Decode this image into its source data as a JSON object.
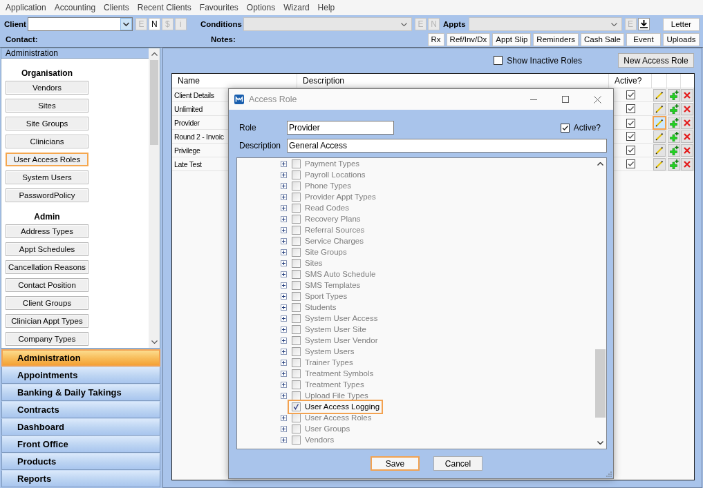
{
  "menu_bar": [
    "Application",
    "Accounting",
    "Clients",
    "Recent Clients",
    "Favourites",
    "Options",
    "Wizard",
    "Help"
  ],
  "toolbar": {
    "lookups": [
      {
        "label": "Client",
        "disabled": false,
        "buttons": [
          {
            "kind": "letter",
            "label": "E",
            "disabled": true
          },
          {
            "kind": "letter",
            "label": "N",
            "disabled": false
          },
          {
            "kind": "letter",
            "label": "$",
            "disabled": true
          },
          {
            "kind": "letter",
            "label": "i",
            "disabled": true
          }
        ]
      },
      {
        "label": "Conditions",
        "disabled": true,
        "buttons": [
          {
            "kind": "letter",
            "label": "E",
            "disabled": true
          },
          {
            "kind": "letter",
            "label": "N",
            "disabled": true
          }
        ]
      },
      {
        "label": "Appts",
        "disabled": true,
        "buttons": [
          {
            "kind": "letter",
            "label": "E",
            "disabled": true
          },
          {
            "kind": "download",
            "disabled": false
          }
        ]
      }
    ],
    "letter_button": "Letter",
    "contact_label": "Contact:",
    "notes_label": "Notes:",
    "buttons": [
      "Rx",
      "Ref/Inv/Dx",
      "Appt Slip",
      "Reminders",
      "Cash Sale",
      "Event",
      "Uploads"
    ]
  },
  "sidebar": {
    "header": "Administration",
    "sections": [
      {
        "title": "Organisation",
        "items": [
          {
            "label": "Vendors",
            "highlighted": false
          },
          {
            "label": "Sites",
            "highlighted": false
          },
          {
            "label": "Site Groups",
            "highlighted": false
          },
          {
            "label": "Clinicians",
            "highlighted": false
          },
          {
            "label": "User Access Roles",
            "highlighted": true
          },
          {
            "label": "System Users",
            "highlighted": false
          },
          {
            "label": "PasswordPolicy",
            "highlighted": false
          }
        ]
      },
      {
        "title": "Admin",
        "items": [
          {
            "label": "Address Types",
            "highlighted": false
          },
          {
            "label": "Appt Schedules",
            "highlighted": false
          },
          {
            "label": "Cancellation Reasons",
            "highlighted": false
          },
          {
            "label": "Contact Position",
            "highlighted": false
          },
          {
            "label": "Client Groups",
            "highlighted": false
          },
          {
            "label": "Clinician Appt Types",
            "highlighted": false
          },
          {
            "label": "Company Types",
            "highlighted": false
          }
        ]
      }
    ],
    "nav": [
      {
        "label": "Administration",
        "selected": true
      },
      {
        "label": "Appointments",
        "selected": false
      },
      {
        "label": "Banking & Daily Takings",
        "selected": false
      },
      {
        "label": "Contracts",
        "selected": false
      },
      {
        "label": "Dashboard",
        "selected": false
      },
      {
        "label": "Front Office",
        "selected": false
      },
      {
        "label": "Products",
        "selected": false
      },
      {
        "label": "Reports",
        "selected": false
      }
    ]
  },
  "roles_panel": {
    "show_inactive": {
      "label": "Show Inactive Roles",
      "checked": false
    },
    "new_button": "New Access Role",
    "table": {
      "columns": [
        "Name",
        "Description",
        "Active?"
      ],
      "rows": [
        {
          "name": "Client Details",
          "active": true,
          "edit_highlighted": false
        },
        {
          "name": "Unlimited",
          "active": true,
          "edit_highlighted": false
        },
        {
          "name": "Provider",
          "active": true,
          "edit_highlighted": true
        },
        {
          "name": "Round 2 - Invoic",
          "active": true,
          "edit_highlighted": false
        },
        {
          "name": "Privilege",
          "active": true,
          "edit_highlighted": false
        },
        {
          "name": "Late Test",
          "active": true,
          "edit_highlighted": false
        }
      ]
    }
  },
  "dialog": {
    "title": "Access Role",
    "role_label": "Role",
    "role_value": "Provider",
    "active": {
      "label": "Active?",
      "checked": true
    },
    "description_label": "Description",
    "description_value": "General Access",
    "tree": [
      {
        "label": "Payment Types",
        "expandable": true,
        "checked": false,
        "highlighted": false
      },
      {
        "label": "Payroll Locations",
        "expandable": true,
        "checked": false,
        "highlighted": false
      },
      {
        "label": "Phone Types",
        "expandable": true,
        "checked": false,
        "highlighted": false
      },
      {
        "label": "Provider Appt Types",
        "expandable": true,
        "checked": false,
        "highlighted": false
      },
      {
        "label": "Read Codes",
        "expandable": true,
        "checked": false,
        "highlighted": false
      },
      {
        "label": "Recovery Plans",
        "expandable": true,
        "checked": false,
        "highlighted": false
      },
      {
        "label": "Referral Sources",
        "expandable": true,
        "checked": false,
        "highlighted": false
      },
      {
        "label": "Service Charges",
        "expandable": true,
        "checked": false,
        "highlighted": false
      },
      {
        "label": "Site Groups",
        "expandable": true,
        "checked": false,
        "highlighted": false
      },
      {
        "label": "Sites",
        "expandable": true,
        "checked": false,
        "highlighted": false
      },
      {
        "label": "SMS Auto Schedule",
        "expandable": true,
        "checked": false,
        "highlighted": false
      },
      {
        "label": "SMS Templates",
        "expandable": true,
        "checked": false,
        "highlighted": false
      },
      {
        "label": "Sport Types",
        "expandable": true,
        "checked": false,
        "highlighted": false
      },
      {
        "label": "Students",
        "expandable": true,
        "checked": false,
        "highlighted": false
      },
      {
        "label": "System User Access",
        "expandable": true,
        "checked": false,
        "highlighted": false
      },
      {
        "label": "System User Site",
        "expandable": true,
        "checked": false,
        "highlighted": false
      },
      {
        "label": "System User Vendor",
        "expandable": true,
        "checked": false,
        "highlighted": false
      },
      {
        "label": "System Users",
        "expandable": true,
        "checked": false,
        "highlighted": false
      },
      {
        "label": "Trainer Types",
        "expandable": true,
        "checked": false,
        "highlighted": false
      },
      {
        "label": "Treatment Symbols",
        "expandable": true,
        "checked": false,
        "highlighted": false
      },
      {
        "label": "Treatment Types",
        "expandable": true,
        "checked": false,
        "highlighted": false
      },
      {
        "label": "Upload File Types",
        "expandable": true,
        "checked": false,
        "highlighted": false
      },
      {
        "label": "User Access Logging",
        "expandable": false,
        "checked": true,
        "highlighted": true
      },
      {
        "label": "User Access Roles",
        "expandable": true,
        "checked": false,
        "highlighted": false
      },
      {
        "label": "User Groups",
        "expandable": true,
        "checked": false,
        "highlighted": false
      },
      {
        "label": "Vendors",
        "expandable": true,
        "checked": false,
        "highlighted": false
      }
    ],
    "buttons": [
      {
        "label": "Save",
        "highlighted": true
      },
      {
        "label": "Cancel",
        "highlighted": false
      }
    ]
  }
}
